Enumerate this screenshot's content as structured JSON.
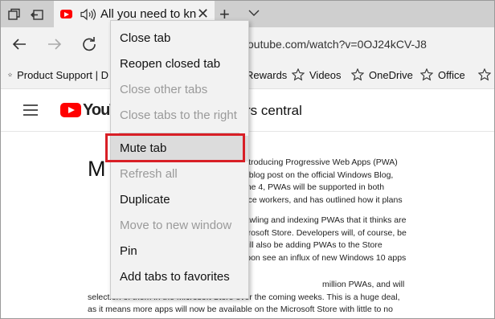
{
  "tab": {
    "title": "All you need to knc"
  },
  "addressbar": {
    "url_visible": "youtube.com/watch?v=0OJ24kCV-J8"
  },
  "favorites": [
    {
      "label": "Product Support | D"
    },
    {
      "label": "Rewards"
    },
    {
      "label": "Videos"
    },
    {
      "label": "OneDrive"
    },
    {
      "label": "Office"
    }
  ],
  "page": {
    "logo_text": "YouT",
    "search_fragment": "rs central",
    "dropcap": "M",
    "paragraphs": [
      [
        "introducing Progressive Web Apps (PWA)",
        "n blog post on the official Windows Blog,",
        "one 4, PWAs will be supported in both",
        "vice workers, and has outlined how it plans"
      ],
      [
        "rawling and indexing PWAs that it thinks are",
        "icrosoft Store. Developers will, of course, be",
        "will also be adding PWAs to the Store",
        "soon see an influx of new Windows 10 apps"
      ],
      [
        "million PWAs, and will roll out a small",
        "selection of them in the Microsoft Store over the coming weeks. This is a huge deal,",
        "as it means more apps will now be available on the Microsoft Store with little to no"
      ]
    ]
  },
  "context_menu": {
    "items": [
      {
        "label": "Close tab",
        "enabled": true
      },
      {
        "label": "Reopen closed tab",
        "enabled": true
      },
      {
        "label": "Close other tabs",
        "enabled": false
      },
      {
        "label": "Close tabs to the right",
        "enabled": false
      },
      {
        "label": "Mute tab",
        "enabled": true,
        "highlighted": true
      },
      {
        "label": "Refresh all",
        "enabled": false
      },
      {
        "label": "Duplicate",
        "enabled": true
      },
      {
        "label": "Move to new window",
        "enabled": false
      },
      {
        "label": "Pin",
        "enabled": true
      },
      {
        "label": "Add tabs to favorites",
        "enabled": true
      }
    ]
  },
  "colors": {
    "youtube_red": "#ff0000",
    "callout_red": "#d81f26",
    "chrome_gray": "#f2f2f2",
    "tabstrip_gray": "#cfcfcf",
    "disabled_text": "#9a9a9a"
  }
}
